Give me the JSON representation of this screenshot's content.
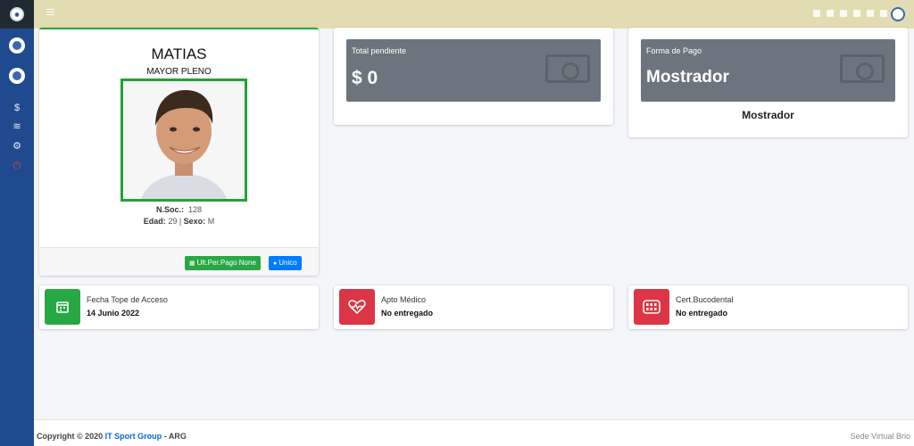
{
  "sidebar": {
    "items": [
      {
        "icon": "dollar-icon",
        "glyph": "$"
      },
      {
        "icon": "layers-icon",
        "glyph": "≋"
      },
      {
        "icon": "cogs-icon",
        "glyph": "⚙"
      },
      {
        "icon": "power-icon",
        "glyph": "⏻"
      }
    ]
  },
  "profile": {
    "name": "MATIAS",
    "category": "MAYOR PLENO",
    "member_no_label": "N.Soc.:",
    "member_no": "128",
    "age_label": "Edad:",
    "age": "29",
    "sex_label": "Sexo:",
    "sex": "M",
    "last_payment_button": "Ult.Per.Pago  None",
    "plan_button": "Unico"
  },
  "total_pending": {
    "label": "Total pendiente",
    "value": "$ 0",
    "icon": "money-bill-icon"
  },
  "payment_method": {
    "label": "Forma de Pago",
    "value": "Mostrador",
    "subtitle": "Mostrador",
    "icon": "money-bill-icon"
  },
  "info_boxes": [
    {
      "label": "Fecha Tope de Acceso",
      "value": "14 Junio 2022",
      "icon": "calendar-icon",
      "color": "#28a745"
    },
    {
      "label": "Apto Médico",
      "value": "No entregado",
      "icon": "heartbeat-icon",
      "color": "#dc3545"
    },
    {
      "label": "Cert.Bucodental",
      "value": "No entregado",
      "icon": "teeth-icon",
      "color": "#dc3545"
    }
  ],
  "footer": {
    "copyright": "Copyright © 2020",
    "brand": "IT Sport Group",
    "suffix": "- ARG",
    "right": "Sede Virtual Brio"
  },
  "colors": {
    "sidebar": "#1f4a8f",
    "topbar": "#e2dcb2",
    "success": "#28a745",
    "danger": "#dc3545",
    "primary": "#007bff",
    "stat_box": "#6c757d"
  }
}
